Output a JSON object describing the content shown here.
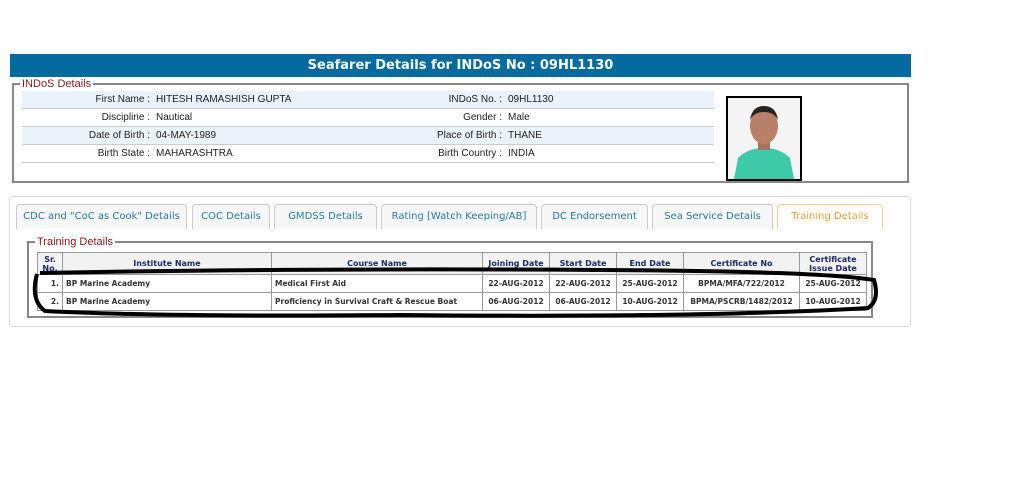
{
  "header": {
    "title": "Seafarer Details for INDoS No : 09HL1130"
  },
  "indos": {
    "legend": "INDoS Details",
    "rows": [
      {
        "l1": "First Name :",
        "v1": "HITESH RAMASHISH GUPTA",
        "l2": "INDoS No. :",
        "v2": "09HL1130"
      },
      {
        "l1": "Discipline :",
        "v1": "Nautical",
        "l2": "Gender :",
        "v2": "Male"
      },
      {
        "l1": "Date of Birth :",
        "v1": "04-MAY-1989",
        "l2": "Place of Birth :",
        "v2": "THANE"
      },
      {
        "l1": "Birth State :",
        "v1": "MAHARASHTRA",
        "l2": "Birth Country :",
        "v2": "INDIA"
      }
    ]
  },
  "tabs": [
    "CDC and \"CoC as Cook\" Details",
    "COC Details",
    "GMDSS Details",
    "Rating [Watch Keeping/AB]",
    "DC Endorsement",
    "Sea Service Details",
    "Training Details"
  ],
  "training": {
    "legend": "Training Details",
    "columns": [
      "Sr. No.",
      "Institute Name",
      "Course Name",
      "Joining Date",
      "Start Date",
      "End Date",
      "Certificate No",
      "Certificate Issue Date"
    ],
    "rows": [
      [
        "1.",
        "BP Marine Academy",
        "Medical First Aid",
        "22-AUG-2012",
        "22-AUG-2012",
        "25-AUG-2012",
        "BPMA/MFA/722/2012",
        "25-AUG-2012"
      ],
      [
        "2.",
        "BP Marine Academy",
        "Proficiency in Survival Craft & Rescue Boat",
        "06-AUG-2012",
        "06-AUG-2012",
        "10-AUG-2012",
        "BPMA/PSCRB/1482/2012",
        "10-AUG-2012"
      ]
    ]
  }
}
